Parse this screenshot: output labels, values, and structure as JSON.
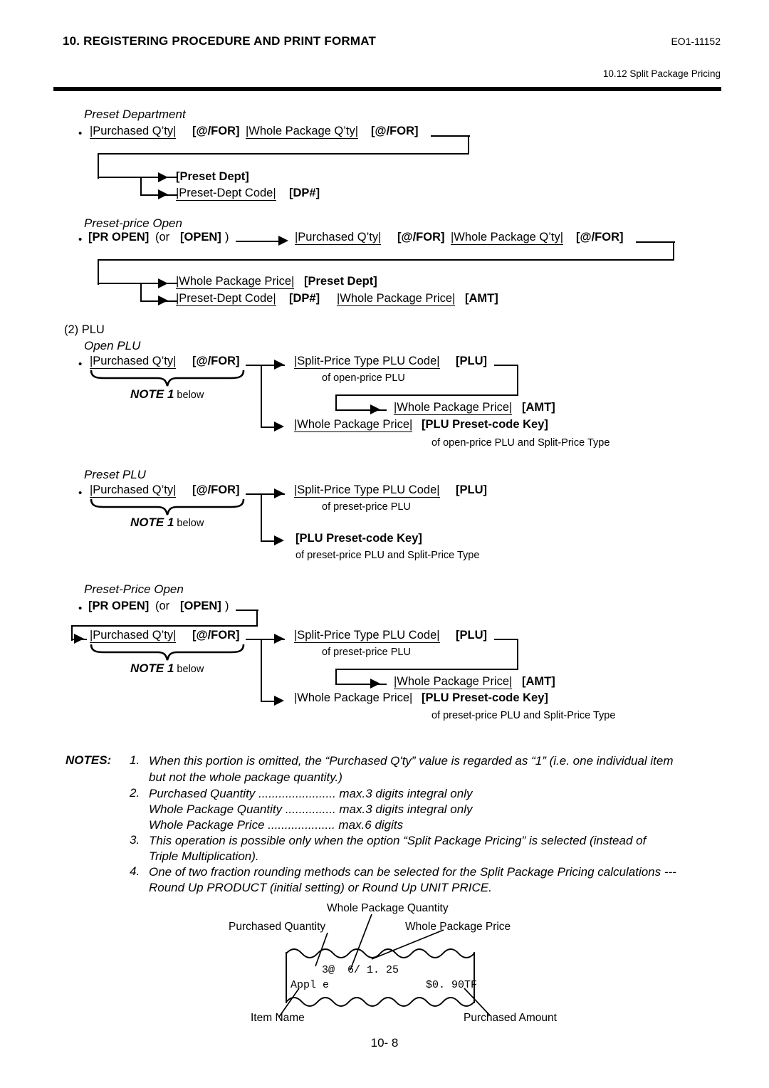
{
  "header": {
    "title": "10. REGISTERING PROCEDURE AND PRINT FORMAT",
    "doc_code": "EO1-11152",
    "subsection": "10.12 Split Package Pricing"
  },
  "page_number": "10- 8",
  "sections": {
    "preset_department": {
      "heading": "Preset Department",
      "bullet": "•",
      "line1": {
        "f1": "|Purchased Q’ty|",
        "k1": "[@/FOR]",
        "f2": "|Whole Package Q’ty|",
        "k2": "[@/FOR]"
      },
      "branch_a": "[Preset Dept]",
      "branch_b_field": "|Preset-Dept Code|",
      "branch_b_key": "[DP#]"
    },
    "preset_price_open_dept": {
      "heading": "Preset-price Open",
      "bullet": "•",
      "key_pr_open": "[PR OPEN]",
      "or_text": "(or",
      "key_open": "[OPEN]",
      "close_paren": ")",
      "f1": "|Purchased Q’ty|",
      "k1": "[@/FOR]",
      "f2": "|Whole Package Q’ty|",
      "k2": "[@/FOR]",
      "branch_a_field": "|Whole Package Price|",
      "branch_a_key": "[Preset Dept]",
      "branch_b_field1": "|Preset-Dept Code|",
      "branch_b_key1": "[DP#]",
      "branch_b_field2": "|Whole Package Price|",
      "branch_b_key2": "[AMT]"
    },
    "plu": {
      "number_label": "(2) PLU",
      "open_plu": {
        "heading": "Open PLU",
        "bullet": "•",
        "f1": "|Purchased Q’ty|",
        "k1": "[@/FOR]",
        "note_ref_bold": "NOTE 1",
        "note_ref_rest": " below",
        "branch_a_field": "|Split-Price Type PLU Code|",
        "branch_a_key": "[PLU]",
        "branch_a_sub": "of open-price PLU",
        "branch_a2_field": "|Whole Package Price|",
        "branch_a2_key": "[AMT]",
        "branch_b_field": "|Whole Package Price|",
        "branch_b_key": "[PLU Preset-code Key]",
        "branch_b_sub": "of open-price PLU and Split-Price Type"
      },
      "preset_plu": {
        "heading": "Preset PLU",
        "bullet": "•",
        "f1": "|Purchased Q’ty|",
        "k1": "[@/FOR]",
        "note_ref_bold": "NOTE 1",
        "note_ref_rest": " below",
        "branch_a_field": "|Split-Price Type PLU Code|",
        "branch_a_key": "[PLU]",
        "branch_a_sub": "of preset-price PLU",
        "branch_b_key": "[PLU Preset-code Key]",
        "branch_b_sub": "of preset-price PLU and Split-Price Type"
      },
      "preset_price_open_plu": {
        "heading": "Preset-Price Open",
        "bullet": "•",
        "key_pr_open": "[PR OPEN]",
        "or_text": "(or",
        "key_open": "[OPEN]",
        "close_paren": ")",
        "f1": "|Purchased Q’ty|",
        "k1": "[@/FOR]",
        "note_ref_bold": "NOTE 1",
        "note_ref_rest": " below",
        "branch_a_field": "|Split-Price Type PLU Code|",
        "branch_a_key": "[PLU]",
        "branch_a_sub": "of preset-price PLU",
        "branch_a2_field": "|Whole Package Price|",
        "branch_a2_key": "[AMT]",
        "branch_b_field": "|Whole Package Price|",
        "branch_b_key": "[PLU Preset-code Key]",
        "branch_b_sub": "of preset-price PLU and Split-Price Type"
      }
    }
  },
  "notes": {
    "label": "NOTES:",
    "items": [
      {
        "num": "1.",
        "lines": [
          "When this portion is omitted, the “Purchased Q'ty” value is regarded as “1” (i.e. one individual item",
          "but not the whole package quantity.)"
        ]
      },
      {
        "num": "2.",
        "lines": [
          "Purchased Quantity ....................... max.3 digits integral only",
          "Whole Package Quantity ............... max.3 digits integral only",
          "Whole Package Price .................... max.6 digits"
        ]
      },
      {
        "num": "3.",
        "lines": [
          "This operation is possible only when the option “Split Package Pricing” is selected (instead of",
          "Triple Multiplication)."
        ]
      },
      {
        "num": "4.",
        "lines": [
          "One of two fraction rounding methods can be selected for the Split Package Pricing calculations ---",
          "Round Up PRODUCT (initial setting) or Round Up UNIT PRICE."
        ]
      }
    ]
  },
  "receipt_figure": {
    "labels": {
      "whole_package_quantity": "Whole Package Quantity",
      "purchased_quantity": "Purchased Quantity",
      "whole_package_price": "Whole Package Price",
      "item_name": "Item Name",
      "purchased_amount": "Purchased Amount"
    },
    "print_lines": {
      "qty_line": "3@  6/ 1. 25",
      "item_name": "Appl e",
      "amount": "$0. 90TF"
    }
  }
}
